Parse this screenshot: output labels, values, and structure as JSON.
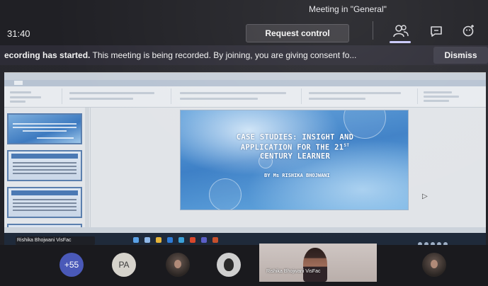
{
  "meeting": {
    "title": "Meeting in \"General\"",
    "timer": "31:40",
    "request_control_label": "Request control"
  },
  "top_icons": [
    "people-icon",
    "chat-icon",
    "reactions-icon"
  ],
  "banner": {
    "bold_text": "ecording has started.",
    "text": "This meeting is being recorded. By joining, you are giving consent fo...",
    "dismiss_label": "Dismiss"
  },
  "shared_screen": {
    "app": "PowerPoint",
    "slide": {
      "title_line1": "CASE STUDIES: INSIGHT AND",
      "title_line2": "APPLICATION FOR THE 21",
      "title_sup": "ST",
      "title_line3": "CENTURY LEARNER",
      "author": "BY Ms RISHIKA BHOJWANI"
    }
  },
  "presenter": {
    "name": "Rishika Bhojwani VisFac"
  },
  "participants": {
    "overflow_count": "+55",
    "initials": "PA",
    "video_name": "Rishika Bhojwani VisFac"
  },
  "colors": {
    "teams_bg": "#202025",
    "banner_bg": "#2d2c36",
    "avatar_count": "#4a59b8",
    "slide_blue": "#3c7fc6"
  }
}
